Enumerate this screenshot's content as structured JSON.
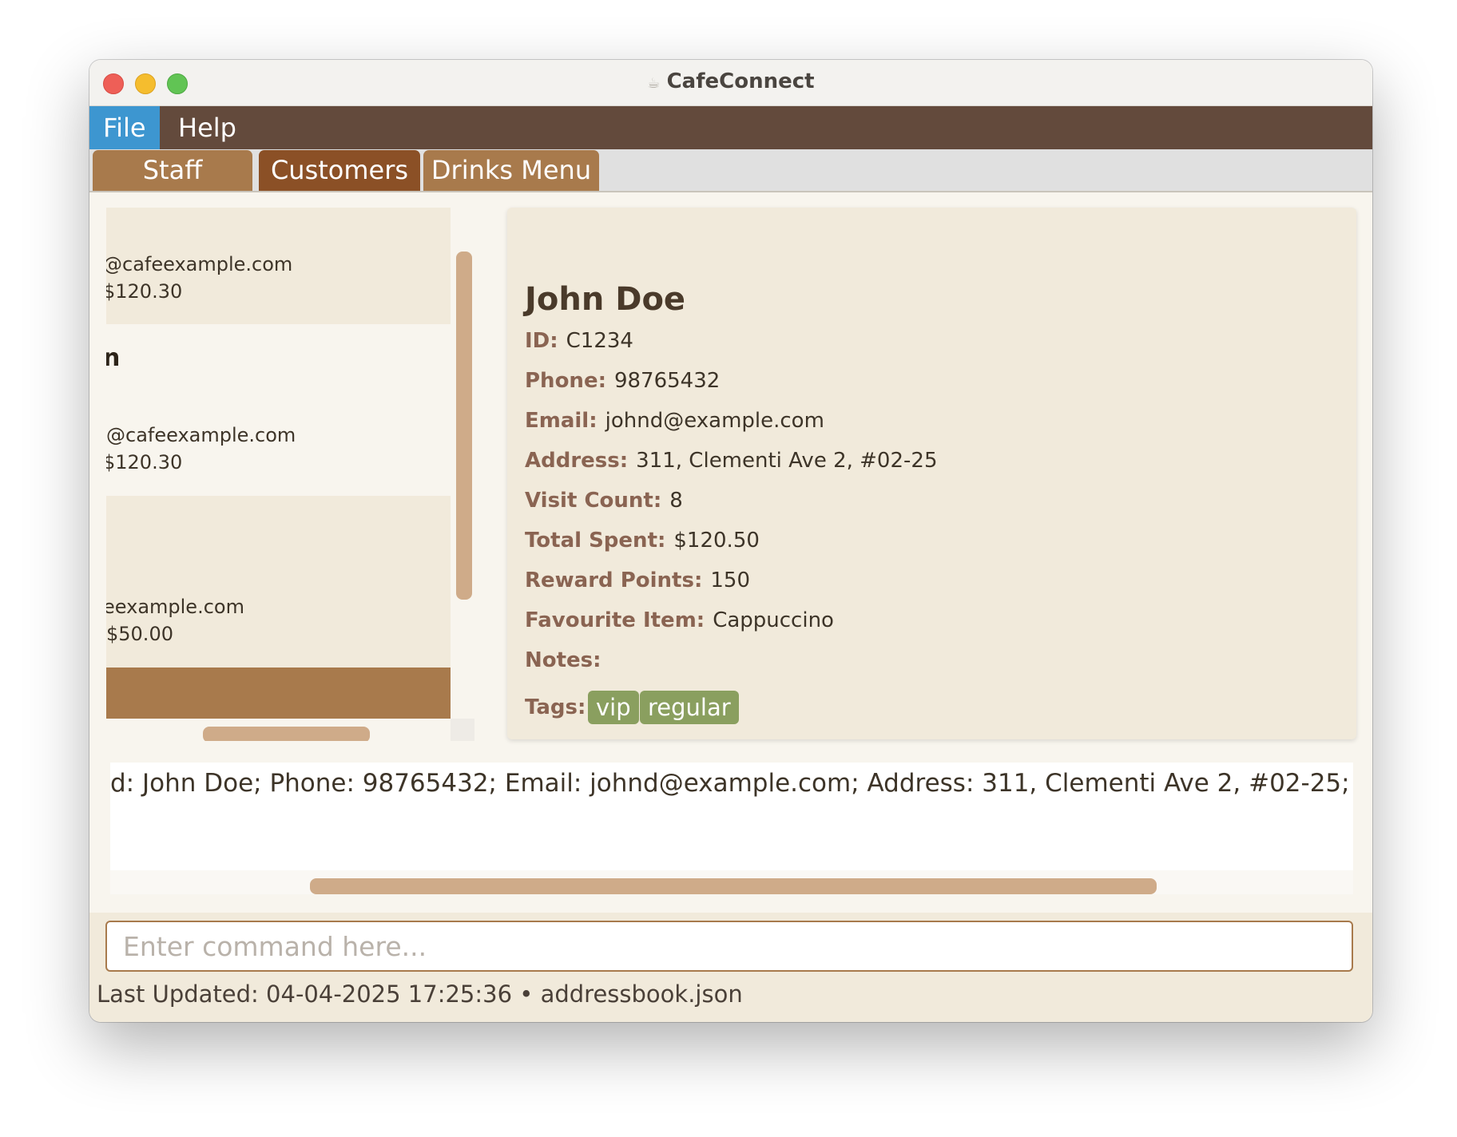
{
  "window": {
    "title": "CafeConnect",
    "app_icon": "coffee-cup-icon"
  },
  "menubar": {
    "items": [
      {
        "label": "File"
      },
      {
        "label": "Help"
      }
    ]
  },
  "tabs": [
    {
      "label": "Staff"
    },
    {
      "label": "Customers"
    },
    {
      "label": "Drinks Menu"
    }
  ],
  "list": {
    "cards": [
      {
        "lines": [
          "@cafeexample.com",
          "$120.30"
        ]
      },
      {
        "name": "n",
        "lines": [
          "@cafeexample.com",
          "$120.30"
        ]
      },
      {
        "lines": [
          "eexample.com",
          "$50.00"
        ]
      }
    ]
  },
  "detail": {
    "name": "John Doe",
    "fields": [
      {
        "label": "ID:",
        "value": "C1234"
      },
      {
        "label": "Phone:",
        "value": "98765432"
      },
      {
        "label": "Email:",
        "value": "johnd@example.com"
      },
      {
        "label": "Address:",
        "value": "311, Clementi Ave 2, #02-25"
      },
      {
        "label": "Visit Count:",
        "value": "8"
      },
      {
        "label": "Total Spent:",
        "value": "$120.50"
      },
      {
        "label": "Reward Points:",
        "value": "150"
      },
      {
        "label": "Favourite Item:",
        "value": "Cappuccino"
      },
      {
        "label": "Notes:",
        "value": ""
      }
    ],
    "tags_label": "Tags:",
    "tags": [
      "vip",
      "regular"
    ]
  },
  "result": {
    "text": "d: John Doe; Phone: 98765432; Email: johnd@example.com; Address: 311, Clementi Ave 2, #02-25;"
  },
  "command": {
    "placeholder": "Enter command here...",
    "value": ""
  },
  "status": {
    "text": "Last Updated: 04-04-2025 17:25:36 • addressbook.json"
  },
  "colors": {
    "menubar": "#634a3c",
    "menu_active": "#3d96d0",
    "tab": "#a87a4c",
    "tab_active": "#8b5026",
    "card_bg": "#f1eadb",
    "tag": "#8a9f5f",
    "scrollbar": "#cfab89"
  }
}
